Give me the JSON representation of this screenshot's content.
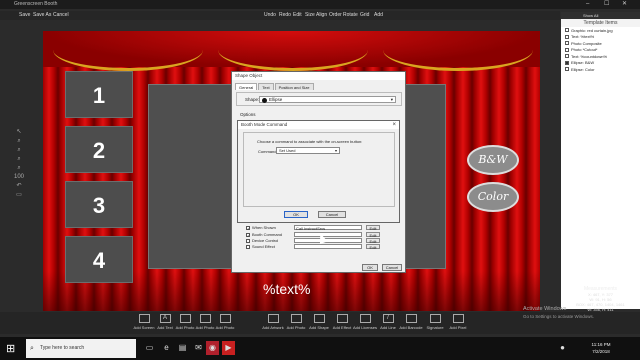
{
  "app": {
    "title": "Greenscreen Booth",
    "window_controls": [
      "–",
      "☐",
      "✕"
    ]
  },
  "menu_left": [
    "Save",
    "Save As",
    "Cancel"
  ],
  "menu_main": [
    "Undo",
    "Redo",
    "Edit",
    "Size",
    "Align",
    "Order",
    "Rotate",
    "Grid",
    "Add"
  ],
  "tools": [
    "↖",
    "⌕",
    "⌕",
    "⌕",
    "⌕",
    "100",
    "↶",
    "▭"
  ],
  "stage": {
    "boxes": [
      "1",
      "2",
      "3",
      "4"
    ],
    "ovals": [
      "B&W",
      "Color"
    ],
    "text": "%text%"
  },
  "panel": {
    "header": "Show All",
    "title": "Template Items",
    "items": [
      {
        "label": "Graphic: red curtain.jpg",
        "checked": false
      },
      {
        "label": "Text: %text%",
        "checked": false
      },
      {
        "label": "Photo Composite",
        "checked": false
      },
      {
        "label": "Photo *Cutout*",
        "checked": false
      },
      {
        "label": "Text: %countdown%",
        "checked": false
      },
      {
        "label": "Ellipse: B&W",
        "checked": true
      },
      {
        "label": "Ellipse: Color",
        "checked": false
      }
    ]
  },
  "measurements": {
    "title": "Measurements",
    "lines": [
      "X: 467, Y: 377",
      "W: 91, H: 56",
      "BOX: 467, 470, 1404, 1461",
      "W: 356, H: 411"
    ]
  },
  "toolbar": [
    "Add Screen",
    "Add Text",
    "Add Photo",
    "Add Photo",
    "Add Photo",
    "Add Artwork",
    "Add Photo",
    "Add Shape",
    "Add Effect",
    "Add Licenses",
    "Add Line",
    "Add Barcode",
    "Signature",
    "Add Pixel"
  ],
  "taskbar": {
    "search_placeholder": "Type here to search",
    "apps": [
      "▭",
      "e",
      "▤",
      "✉",
      "◉",
      "▶",
      "●"
    ],
    "time": "11:16 PM",
    "date": "7/2/2018"
  },
  "watermark": {
    "line1": "Activate Windows",
    "line2": "Go to Settings to activate Windows."
  },
  "shape_dialog": {
    "title": "Shape Object",
    "tabs": [
      "General",
      "Text",
      "Position and Size"
    ],
    "shape_label": "Shape:",
    "shape_value": "Ellipse",
    "options_label": "Options",
    "rows": [
      {
        "label": "When Shown",
        "checked": true,
        "value": "Call InstructSrvs",
        "button": "Edit"
      },
      {
        "label": "Booth Command",
        "checked": true,
        "value": "",
        "button": "Edit"
      },
      {
        "label": "Device Control",
        "checked": false,
        "value": "",
        "button": "Edit"
      },
      {
        "label": "Sound Effect",
        "checked": false,
        "value": "",
        "button": "Edit"
      }
    ],
    "ok": "OK",
    "cancel": "Cancel"
  },
  "booth_dialog": {
    "title": "Booth Mode Command",
    "message": "Choose a command to associate with the on-screen button:",
    "command_label": "Command:",
    "command_value": "Set Used",
    "ok": "OK",
    "cancel": "Cancel"
  }
}
